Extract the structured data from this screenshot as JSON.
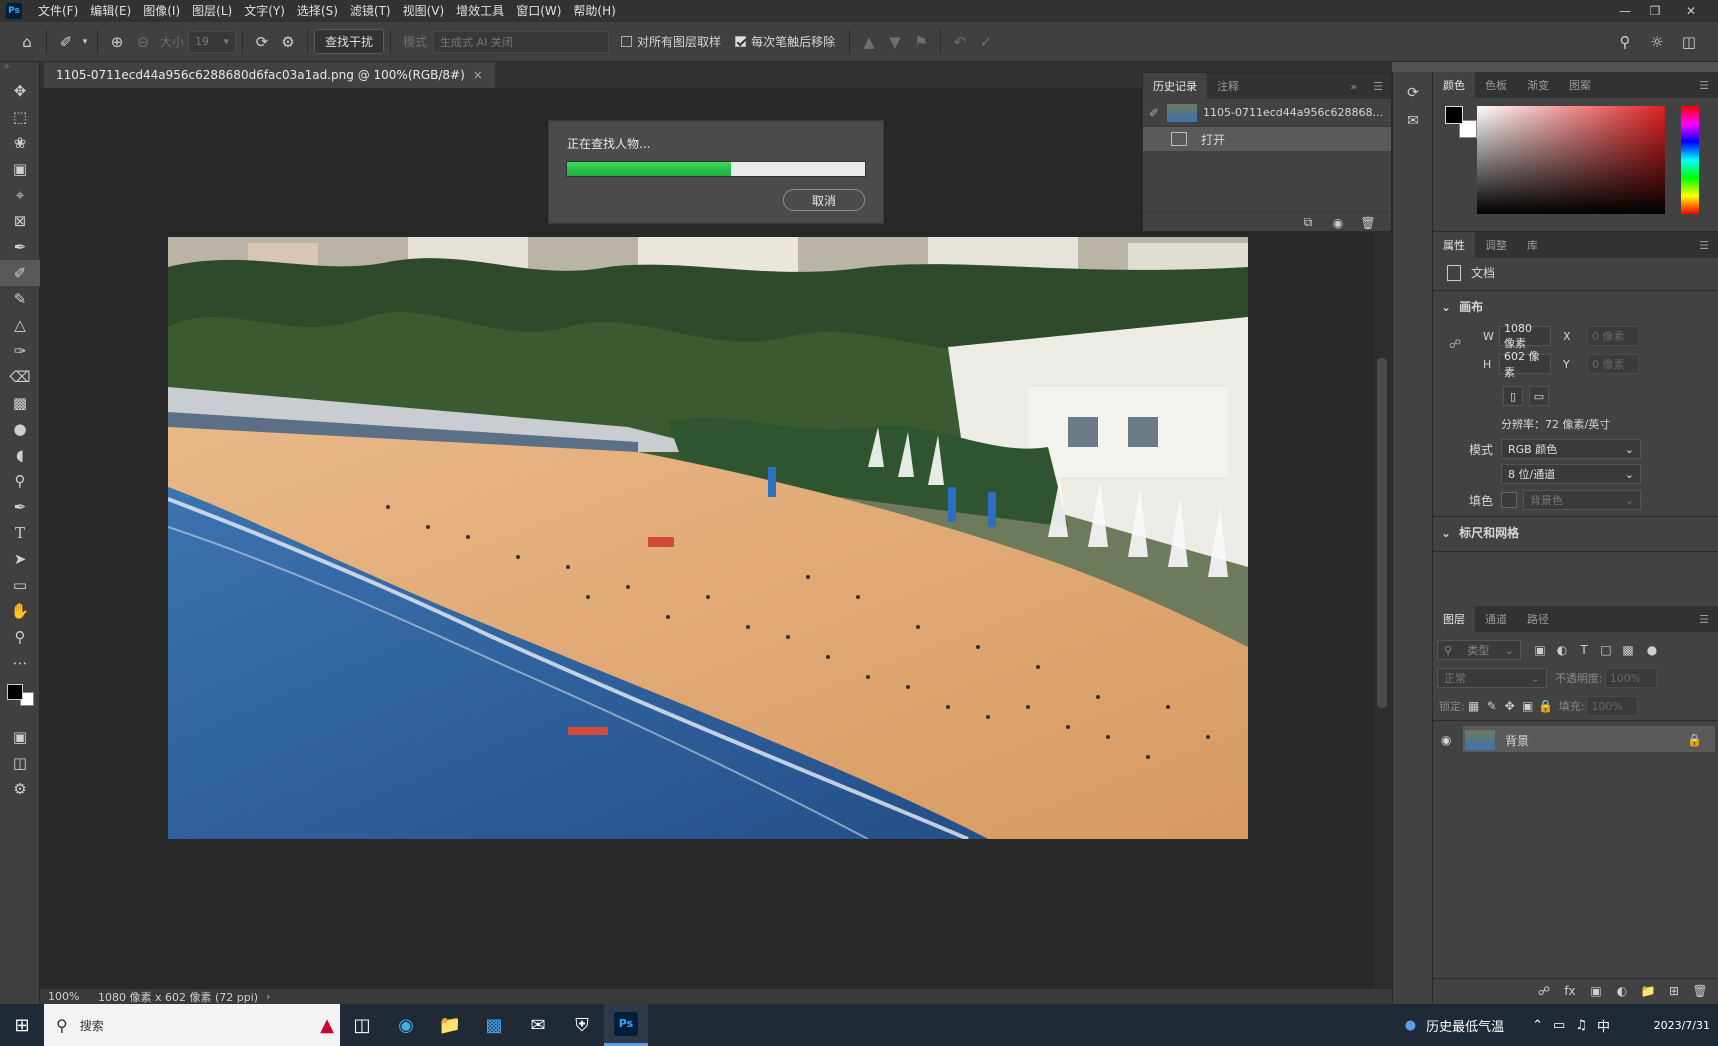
{
  "app": {
    "logo": "Ps"
  },
  "menu": [
    "文件(F)",
    "编辑(E)",
    "图像(I)",
    "图层(L)",
    "文字(Y)",
    "选择(S)",
    "滤镜(T)",
    "视图(V)",
    "增效工具",
    "窗口(W)",
    "帮助(H)"
  ],
  "options": {
    "size_label": "大小",
    "size_value": "19",
    "find_button": "查找干扰",
    "mode_label": "模式",
    "mode_value": "生成式 AI 关闭",
    "sample_all_label": "对所有图层取样",
    "remove_after_label": "每次笔触后移除"
  },
  "document": {
    "tab_title": "1105-0711ecd44a956c6288680d6fac03a1ad.png @ 100%(RGB/8#)",
    "close": "×"
  },
  "dialog": {
    "message": "正在查找人物...",
    "progress": 0.55,
    "cancel": "取消"
  },
  "history": {
    "tabs": [
      "历史记录",
      "注释"
    ],
    "snapshot": "1105-0711ecd44a956c628868...",
    "step": "打开"
  },
  "color_panel": {
    "tabs": [
      "颜色",
      "色板",
      "渐变",
      "图案"
    ]
  },
  "properties": {
    "tabs": [
      "属性",
      "调整",
      "库"
    ],
    "doc_label": "文档",
    "canvas_title": "画布",
    "w_label": "W",
    "w_value": "1080 像素",
    "h_label": "H",
    "h_value": "602 像素",
    "x_label": "X",
    "x_value": "0 像素",
    "y_label": "Y",
    "y_value": "0 像素",
    "resolution": "分辨率：72 像素/英寸",
    "mode_label": "模式",
    "mode_value": "RGB 颜色",
    "bits_value": "8 位/通道",
    "fill_label": "填色",
    "fill_value": "背景色",
    "rulers_title": "标尺和网格"
  },
  "layers": {
    "tabs": [
      "图层",
      "通道",
      "路径"
    ],
    "filter_value": "类型",
    "blend_value": "正常",
    "opacity_label": "不透明度:",
    "opacity_value": "100%",
    "lock_label": "锁定:",
    "fill_label": "填充:",
    "fill_value": "100%",
    "layer_name": "背景"
  },
  "status": {
    "zoom": "100%",
    "info": "1080 像素 x 602 像素 (72 ppi)"
  },
  "taskbar": {
    "search": "搜索",
    "weather": "历史最低气温",
    "ime": "中",
    "date": "2023/7/31"
  },
  "colors": {
    "accent_green": "#2cc94a",
    "ps_blue": "#31a8ff"
  }
}
